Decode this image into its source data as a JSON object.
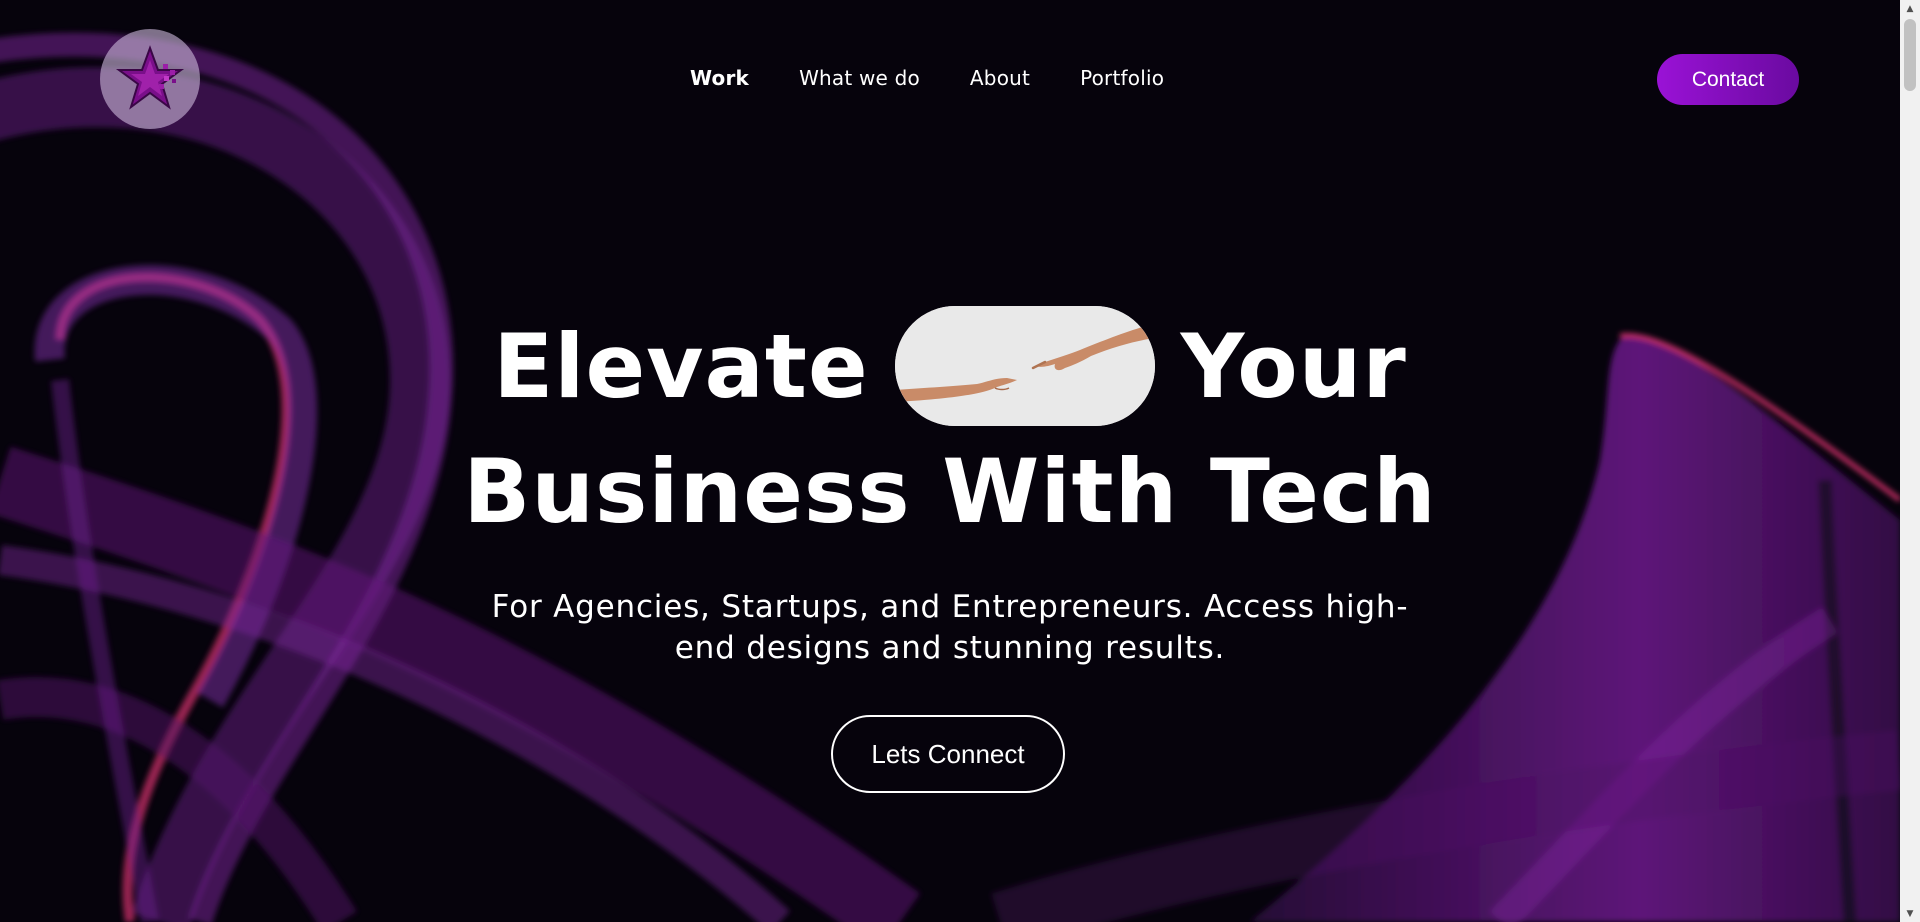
{
  "brand": {
    "logo_icon": "star-pixel-logo-icon",
    "accent_color": "#9a12d6",
    "background_color": "#06030c"
  },
  "nav": {
    "items": [
      {
        "label": "Work",
        "active": true
      },
      {
        "label": "What we do",
        "active": false
      },
      {
        "label": "About",
        "active": false
      },
      {
        "label": "Portfolio",
        "active": false
      }
    ],
    "contact_label": "Contact"
  },
  "hero": {
    "title_word_1": "Elevate",
    "title_word_2": "Your",
    "title_line_2": "Business With Tech",
    "pill_image": "reaching-hands-image",
    "subtitle": "For Agencies, Startups, and Entrepreneurs. Access high-end designs and stunning results.",
    "cta_label": "Lets Connect"
  },
  "scrollbar": {
    "up_icon": "scroll-up-arrow-icon",
    "down_icon": "scroll-down-arrow-icon"
  }
}
